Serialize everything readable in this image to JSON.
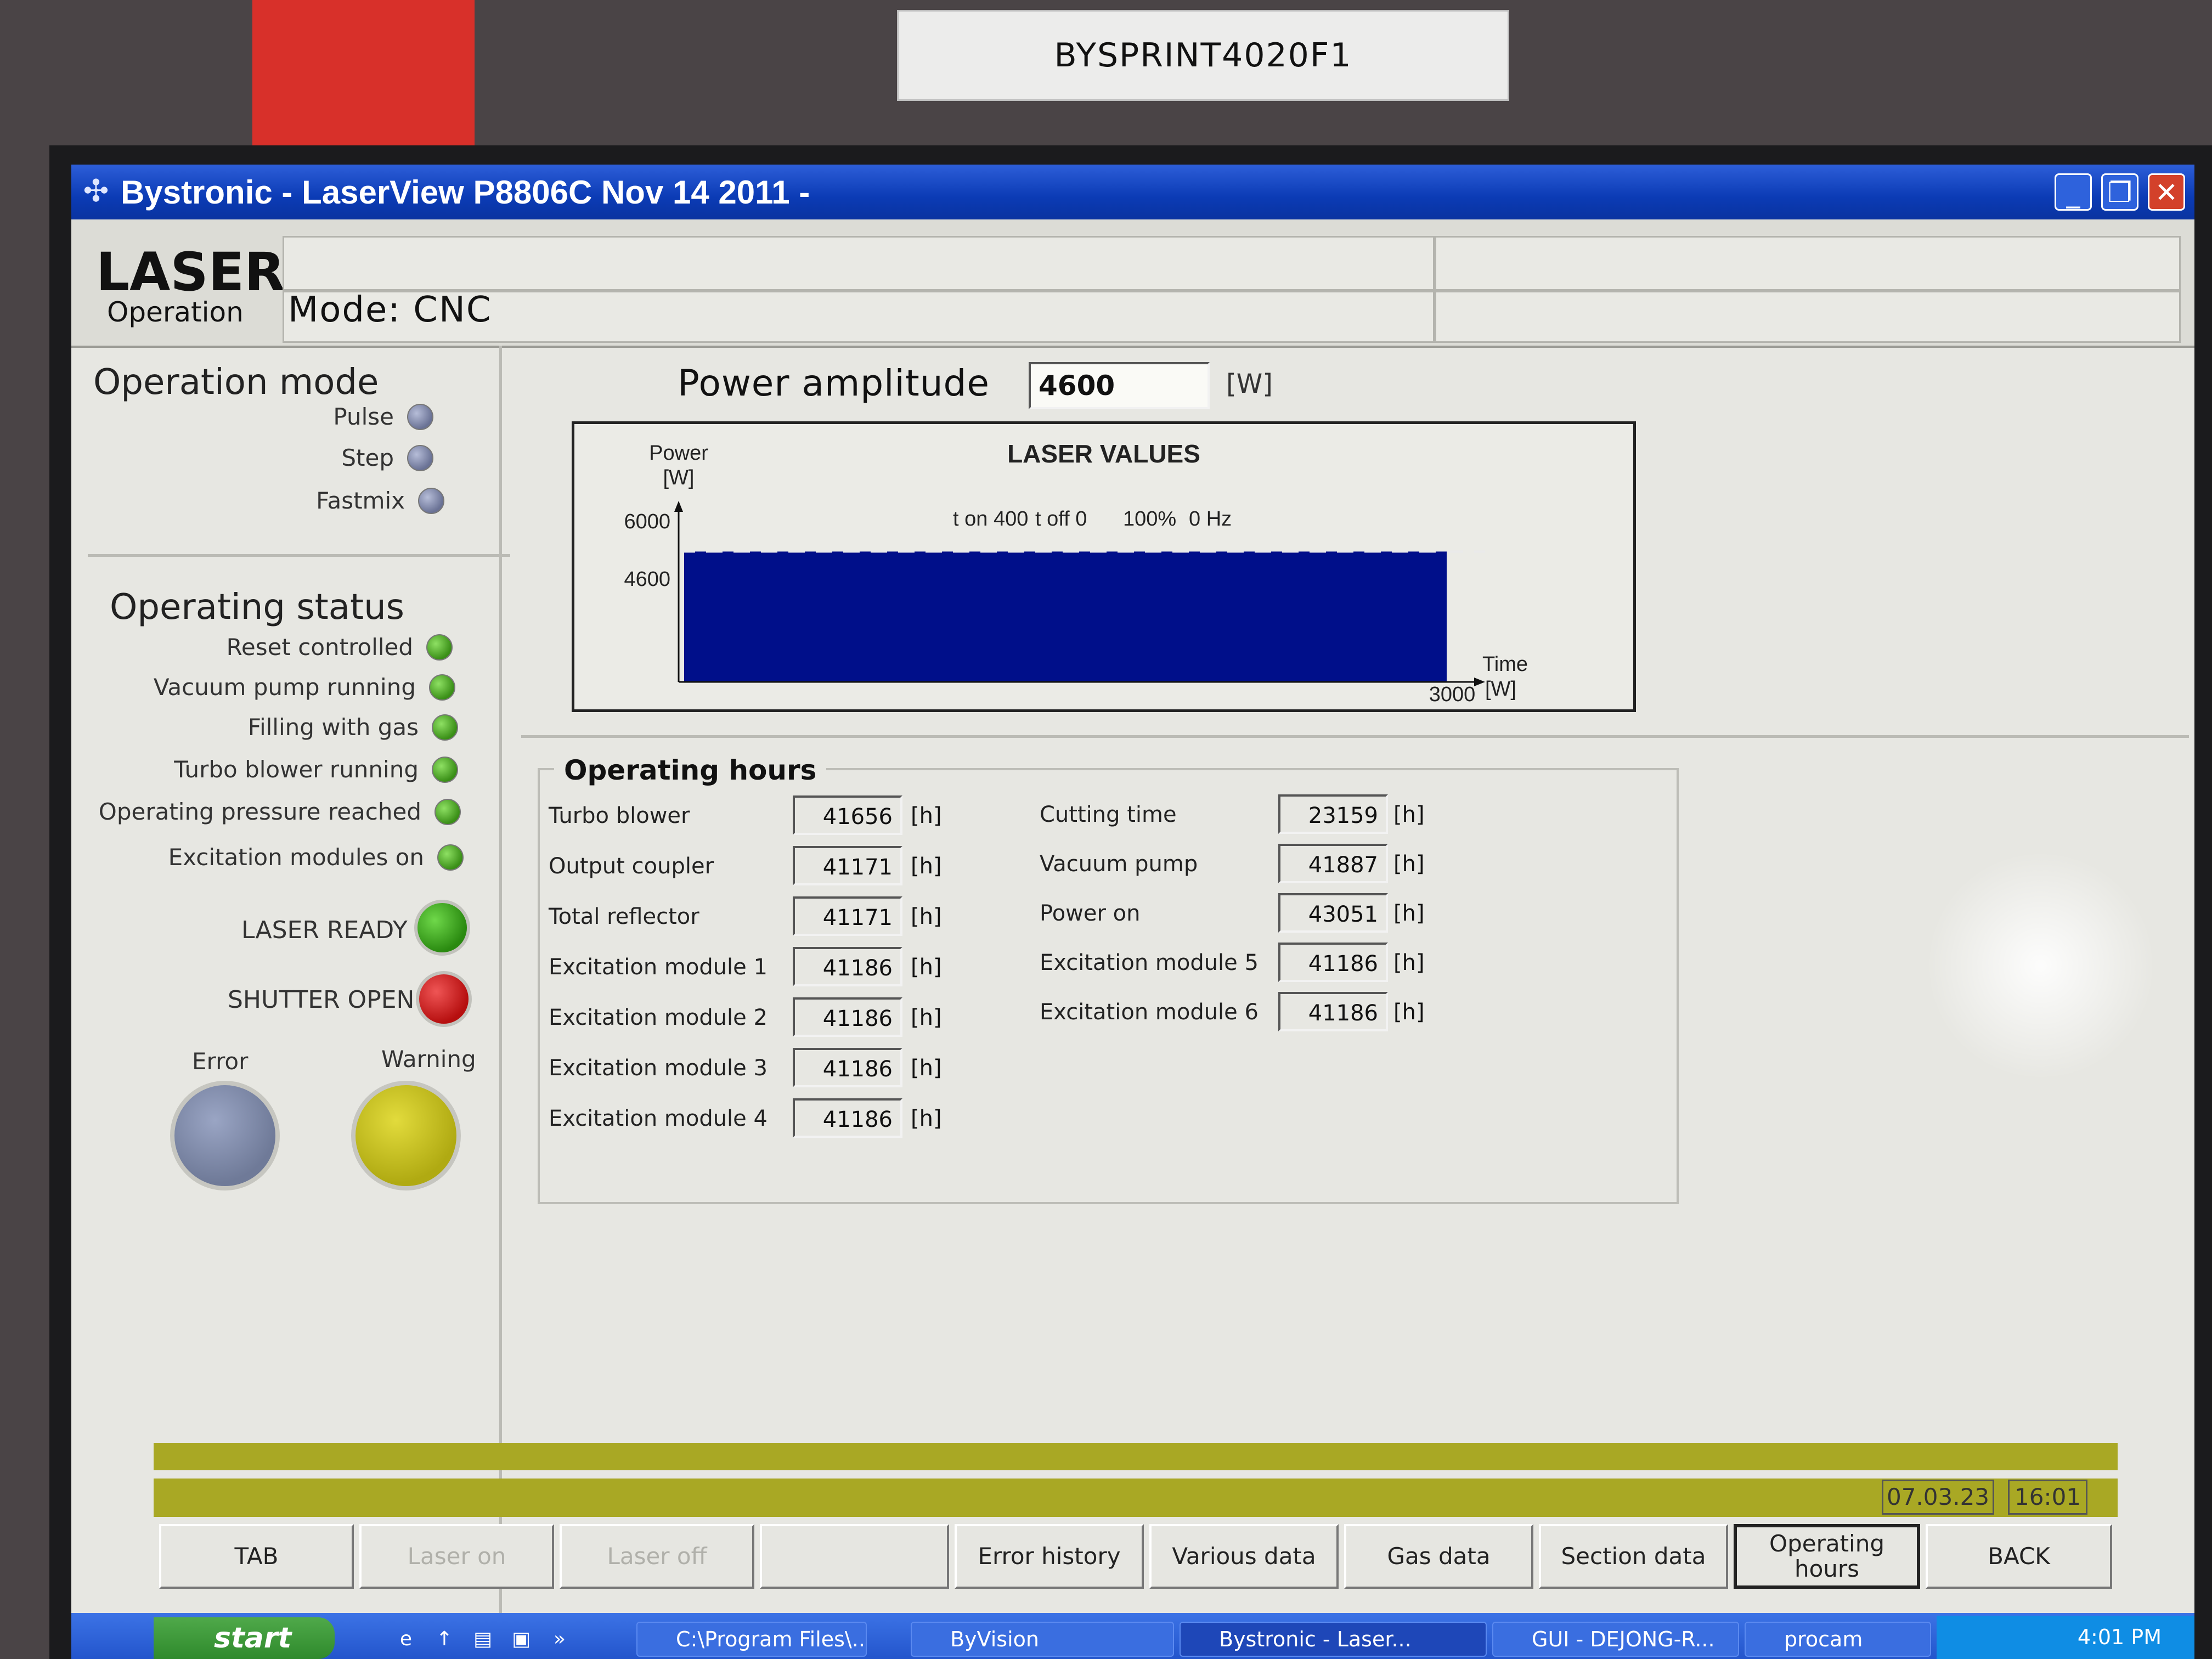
{
  "sticker": {
    "text": "BYSPRINT4020F1"
  },
  "window": {
    "title": "Bystronic - LaserView P8806C  Nov 14 2011 -",
    "minimize": "_",
    "maximize": "❐",
    "close": "✕"
  },
  "header": {
    "title": "LASER",
    "subtitle": "Operation",
    "mode": "Mode: CNC"
  },
  "operation_mode": {
    "title": "Operation mode",
    "items": [
      {
        "label": "Pulse",
        "state": "grey"
      },
      {
        "label": "Step",
        "state": "grey"
      },
      {
        "label": "Fastmix",
        "state": "grey"
      }
    ]
  },
  "operating_status": {
    "title": "Operating status",
    "items": [
      {
        "label": "Reset controlled",
        "state": "green"
      },
      {
        "label": "Vacuum pump running",
        "state": "green"
      },
      {
        "label": "Filling with gas",
        "state": "green"
      },
      {
        "label": "Turbo blower running",
        "state": "green"
      },
      {
        "label": "Operating pressure reached",
        "state": "green"
      },
      {
        "label": "Excitation modules on",
        "state": "green"
      }
    ],
    "laser_ready": "LASER READY",
    "shutter_open": "SHUTTER OPEN",
    "error": "Error",
    "warning": "Warning"
  },
  "power": {
    "label": "Power amplitude",
    "value": "4600",
    "unit": "[W]"
  },
  "chart_data": {
    "type": "area",
    "title": "LASER VALUES",
    "ylabel": "Power\n[W]",
    "xlabel": "Time\n[W]",
    "y_label_top": "Power",
    "y_label_unit": "[W]",
    "x_label_top": "Time",
    "x_label_unit": "[W]",
    "y_ticks": [
      "6000",
      "4600"
    ],
    "x_ticks": [
      "3000"
    ],
    "ylim": [
      0,
      6000
    ],
    "xlim": [
      0,
      3000
    ],
    "series": [
      {
        "x": [
          0,
          3000
        ],
        "values": [
          4600,
          4600
        ]
      }
    ],
    "annotations": [
      "t on 400",
      "t off 0",
      "100%",
      "0 Hz"
    ],
    "colors": {
      "fill": "#000f8a"
    }
  },
  "operating_hours": {
    "title": "Operating hours",
    "left": [
      {
        "label": "Turbo blower",
        "value": "41656",
        "unit": "[h]"
      },
      {
        "label": "Output coupler",
        "value": "41171",
        "unit": "[h]"
      },
      {
        "label": "Total reflector",
        "value": "41171",
        "unit": "[h]"
      },
      {
        "label": "Excitation module 1",
        "value": "41186",
        "unit": "[h]"
      },
      {
        "label": "Excitation module 2",
        "value": "41186",
        "unit": "[h]"
      },
      {
        "label": "Excitation module 3",
        "value": "41186",
        "unit": "[h]"
      },
      {
        "label": "Excitation module 4",
        "value": "41186",
        "unit": "[h]"
      }
    ],
    "right": [
      {
        "label": "Cutting time",
        "value": "23159",
        "unit": "[h]"
      },
      {
        "label": "Vacuum pump",
        "value": "41887",
        "unit": "[h]"
      },
      {
        "label": "Power on",
        "value": "43051",
        "unit": "[h]"
      },
      {
        "label": "Excitation module 5",
        "value": "41186",
        "unit": "[h]"
      },
      {
        "label": "Excitation module 6",
        "value": "41186",
        "unit": "[h]"
      }
    ]
  },
  "status_bar": {
    "date": "07.03.23",
    "time": "16:01"
  },
  "buttons": {
    "tab": "TAB",
    "laser_on": "Laser on",
    "laser_off": "Laser off",
    "blank": "",
    "error_history": "Error history",
    "various_data": "Various data",
    "gas_data": "Gas data",
    "section_data": "Section data",
    "operating_hours": "Operating hours",
    "back": "BACK"
  },
  "taskbar": {
    "start": "start",
    "items": [
      "C:\\Program Files\\...",
      "ByVision",
      "Bystronic - Laser...",
      "GUI - DEJONG-R...",
      "procam"
    ],
    "clock": "4:01 PM"
  },
  "colors": {
    "titlebar": "#0b3bb5",
    "status_green": "#3a8f17",
    "shutter_red": "#c41414",
    "warning_yellow": "#c8c21a",
    "error_grey": "#7a86a6",
    "status_bar": "#a9a824",
    "chart_fill": "#000f8a"
  }
}
